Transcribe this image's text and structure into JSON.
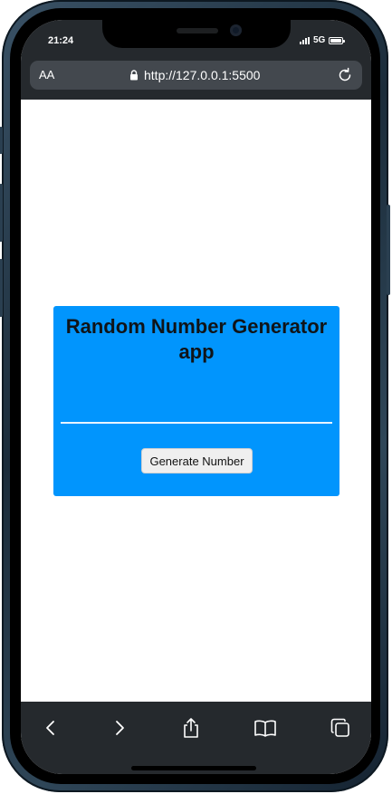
{
  "status_bar": {
    "time": "21:24",
    "network": "5G"
  },
  "browser": {
    "text_size_label": "AA",
    "url": "http://127.0.0.1:5500"
  },
  "app": {
    "title": "Random Number Generator app",
    "result": "",
    "generate_button_label": "Generate Number",
    "card_color": "#0195fd"
  },
  "toolbar": {
    "icons": [
      "back-icon",
      "forward-icon",
      "share-icon",
      "bookmarks-icon",
      "tabs-icon"
    ]
  }
}
